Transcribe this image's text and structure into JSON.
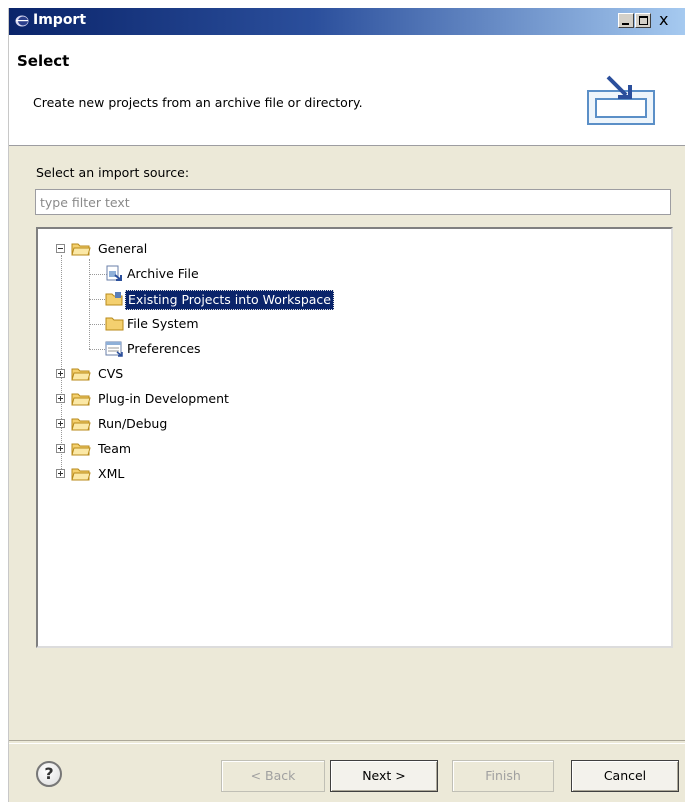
{
  "window": {
    "title": "Import"
  },
  "banner": {
    "title": "Select",
    "description": "Create new projects from an archive file or directory.",
    "icon": "import-wizard-icon"
  },
  "source": {
    "label": "Select an import source:",
    "filter_placeholder": "type filter text"
  },
  "tree": {
    "general": "General",
    "archive_file": "Archive File",
    "existing_projects": "Existing Projects into Workspace",
    "file_system": "File System",
    "preferences": "Preferences",
    "cvs": "CVS",
    "plugin_dev": "Plug-in Development",
    "run_debug": "Run/Debug",
    "team": "Team",
    "xml": "XML"
  },
  "buttons": {
    "help": "?",
    "back": "< Back",
    "next": "Next >",
    "finish": "Finish",
    "cancel": "Cancel"
  }
}
